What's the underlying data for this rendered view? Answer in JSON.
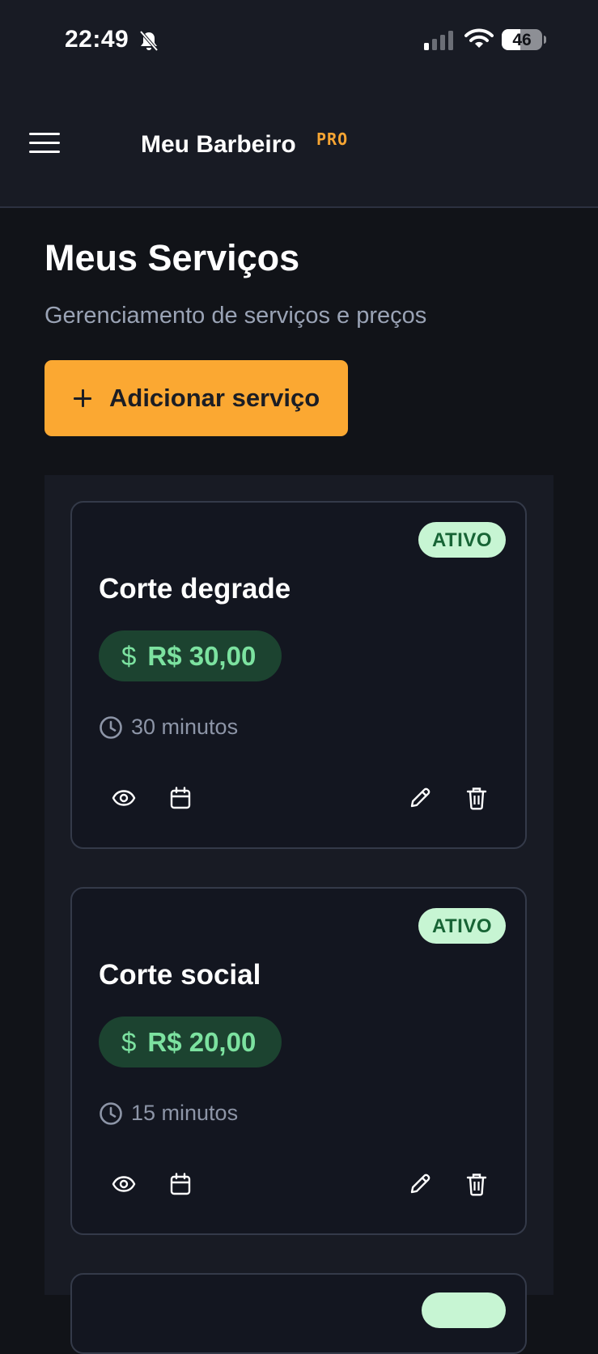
{
  "status_bar": {
    "time": "22:49",
    "battery_level": "46",
    "icons": [
      "bell-off-icon",
      "signal-icon",
      "wifi-icon",
      "battery-icon"
    ]
  },
  "header": {
    "title": "Meu Barbeiro",
    "badge": "PRO",
    "menu_icon": "hamburger-menu-icon"
  },
  "page": {
    "title": "Meus Serviços",
    "subtitle": "Gerenciamento de serviços e preços",
    "add_button_label": "Adicionar serviço"
  },
  "services": [
    {
      "name": "Corte degrade",
      "status": "ATIVO",
      "price": "R$ 30,00",
      "duration": "30 minutos"
    },
    {
      "name": "Corte social",
      "status": "ATIVO",
      "price": "R$ 20,00",
      "duration": "15 minutos"
    }
  ],
  "card_actions": [
    "eye-icon",
    "calendar-icon",
    "pencil-icon",
    "trash-icon"
  ],
  "colors": {
    "background": "#111318",
    "header": "#181b24",
    "accent": "#fba832",
    "pro": "#f6a533",
    "status_badge_bg": "#c7f5d3",
    "status_badge_text": "#176435",
    "price_bg": "#1c4330",
    "price_text": "#7ce2a0"
  }
}
